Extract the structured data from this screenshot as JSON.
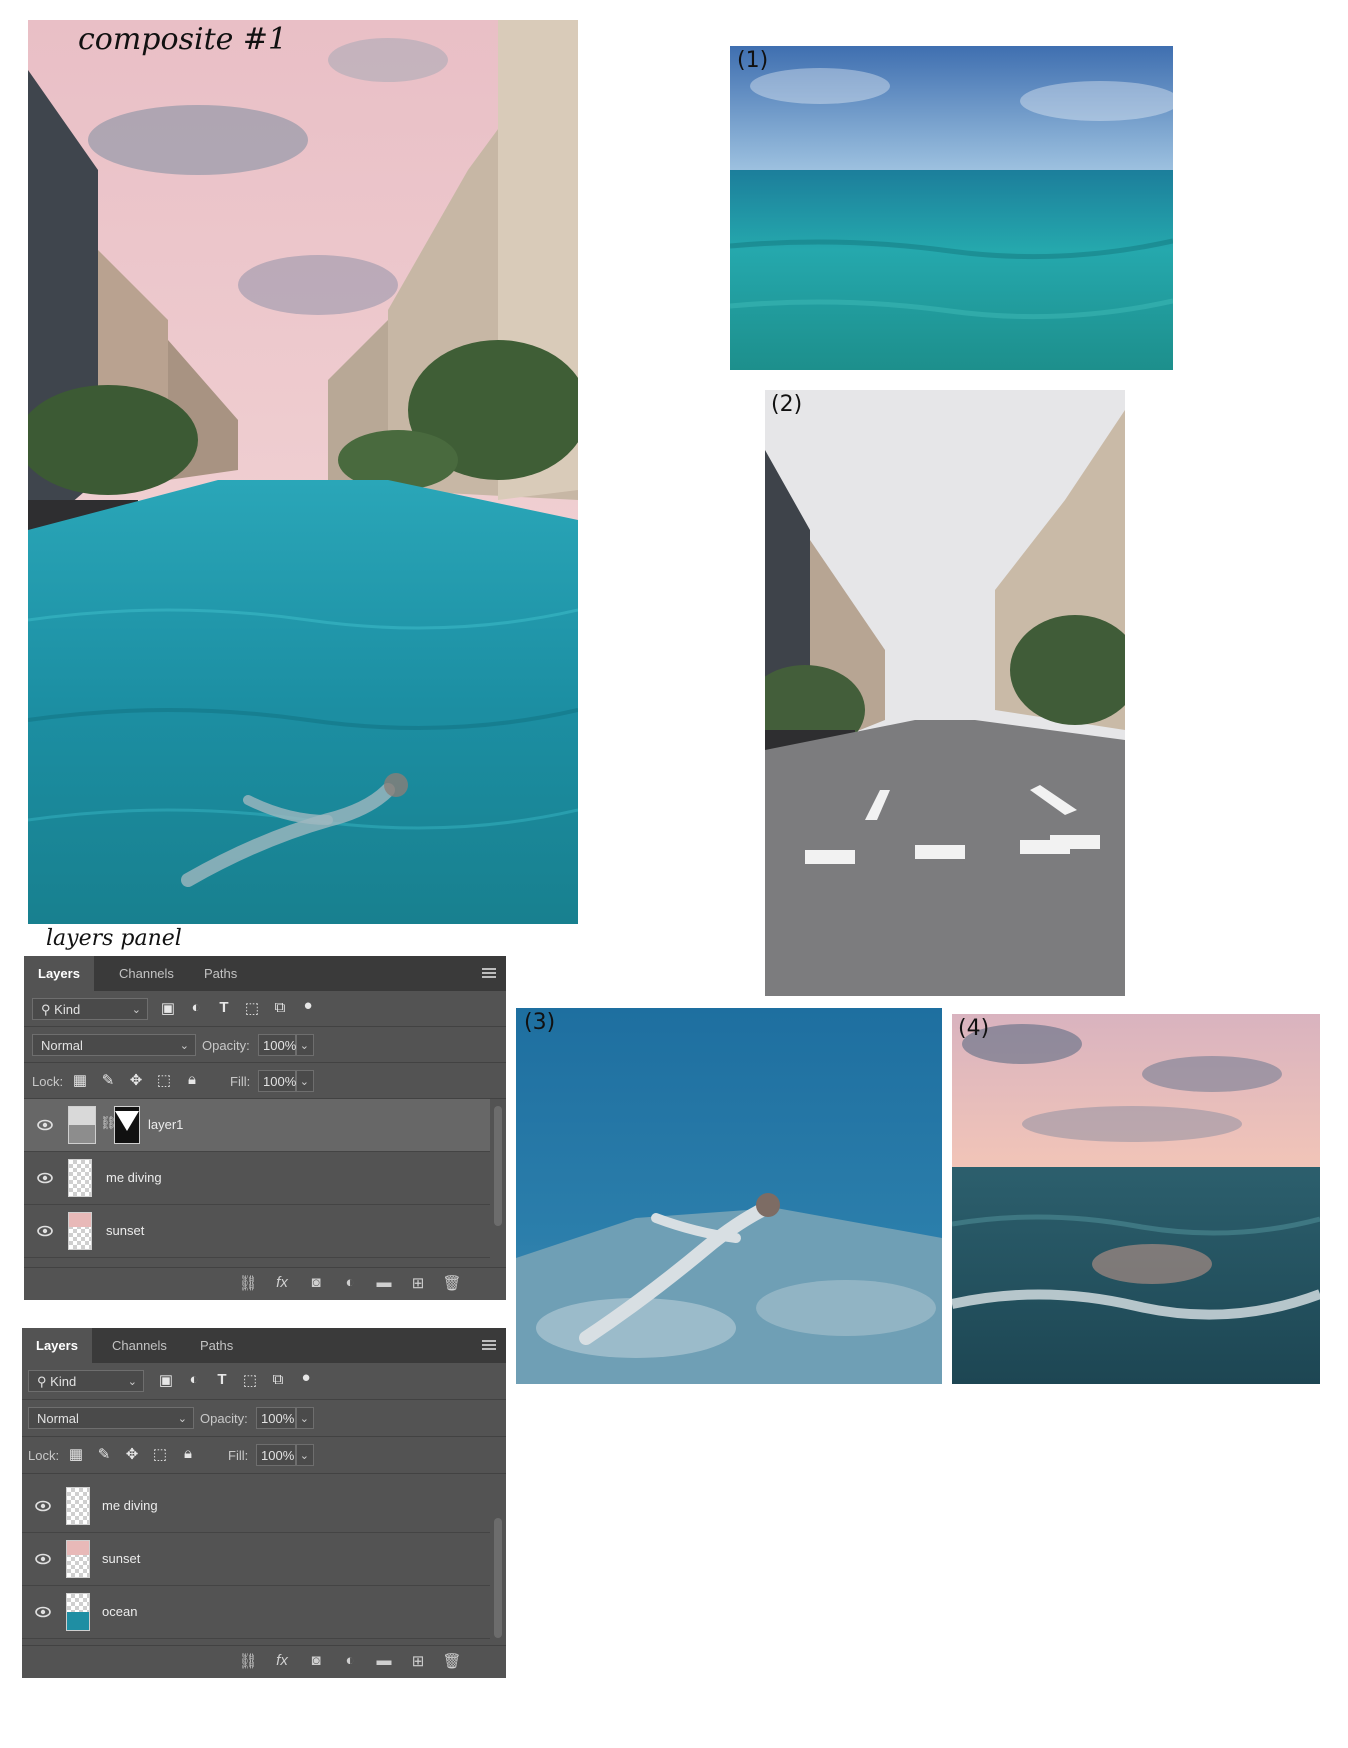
{
  "annotations": {
    "composite_title": "composite #1",
    "layers_panel_label": "layers panel",
    "image_tags": [
      "(1)",
      "(2)",
      "(3)",
      "(4)"
    ]
  },
  "panel1": {
    "tabs": [
      "Layers",
      "Channels",
      "Paths"
    ],
    "filter_kind": "Kind",
    "blend_mode": "Normal",
    "opacity_label": "Opacity:",
    "opacity_value": "100%",
    "lock_label": "Lock:",
    "fill_label": "Fill:",
    "fill_value": "100%",
    "layers": [
      {
        "name": "layer1",
        "selected": true
      },
      {
        "name": "me diving",
        "selected": false
      },
      {
        "name": "sunset",
        "selected": false
      }
    ]
  },
  "panel2": {
    "tabs": [
      "Layers",
      "Channels",
      "Paths"
    ],
    "filter_kind": "Kind",
    "blend_mode": "Normal",
    "opacity_label": "Opacity:",
    "opacity_value": "100%",
    "lock_label": "Lock:",
    "fill_label": "Fill:",
    "fill_value": "100%",
    "layers": [
      {
        "name": "me diving",
        "selected": false
      },
      {
        "name": "sunset",
        "selected": false
      },
      {
        "name": "ocean",
        "selected": false
      }
    ]
  },
  "colors": {
    "panel_bg": "#535353",
    "tab_bar": "#3a3a3a",
    "selected_layer": "#676767",
    "water": "#1f8ea3",
    "sky_pink": "#efc7cc"
  }
}
